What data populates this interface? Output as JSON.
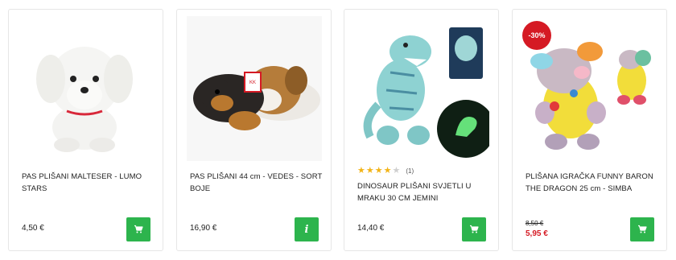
{
  "products": [
    {
      "title": "PAS PLIŠANI MALTESER - LUMO STARS",
      "price": "4,50 €",
      "action": "cart",
      "image_icon": "white-maltese-plush-icon"
    },
    {
      "title": "PAS PLIŠANI 44 cm - VEDES - SORT BOJE",
      "price": "16,90 €",
      "action": "info",
      "image_icon": "plush-dogs-icon"
    },
    {
      "title": "DINOSAUR PLIŠANI SVJETLI U MRAKU 30 CM JEMINI",
      "price": "14,40 €",
      "action": "cart",
      "rating": 4,
      "rating_max": 5,
      "rating_count": "(1)",
      "image_icon": "glow-dinosaur-plush-icon"
    },
    {
      "title": "PLIŠANA IGRAČKA FUNNY BARON THE DRAGON 25 cm - SIMBA",
      "old_price": "8,50 €",
      "new_price": "5,95 €",
      "discount_badge": "-30%",
      "action": "cart",
      "image_icon": "dragon-plush-icon"
    }
  ],
  "colors": {
    "button_green": "#2db44d",
    "sale_red": "#d51a24",
    "star_gold": "#f2b418",
    "border": "#e6e6e6"
  },
  "icons": {
    "cart": "cart-icon",
    "info": "info-icon",
    "star": "star-icon"
  }
}
